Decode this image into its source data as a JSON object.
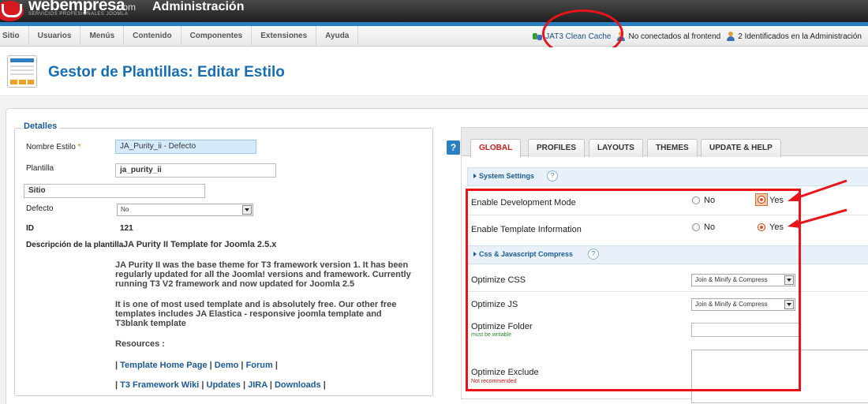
{
  "header": {
    "logo": "webempresa",
    "logo_suffix": ".com",
    "logo_tagline": "SERVICIOS PROFESIONALES JOOMLA",
    "title": "Administración"
  },
  "menu": [
    "Sitio",
    "Usuarios",
    "Menús",
    "Contenido",
    "Componentes",
    "Extensiones",
    "Ayuda"
  ],
  "status": {
    "clean_cache": "JAT3 Clean Cache",
    "frontend": "No conectados al frontend",
    "admin": "2 Identificados en la Administración"
  },
  "toolbar": {
    "title": "Gestor de Plantillas: Editar Estilo"
  },
  "details": {
    "legend": "Detalles",
    "style_name_label": "Nombre Estilo",
    "required_mark": "*",
    "style_name_value": "JA_Purity_ii - Defecto",
    "template_label": "Plantilla",
    "template_value": "ja_purity_ii",
    "client_value": "Sitio",
    "default_label": "Defecto",
    "default_value": "No",
    "id_label": "ID",
    "id_value": "121",
    "desc_label": "Descripción de la plantilla",
    "desc_title": "JA Purity II Template for Joomla 2.5.x",
    "para1_l1": "JA Purity II was the base theme for T3 framework version 1. It has been",
    "para1_l2": "regularly updated for all the Joomla! versions and framework. Currently",
    "para1_l3": "running T3 V2 framework and now updated for Joomla 2.5",
    "para2_l1": "It is one of most used template and is absolutely free. Our other free",
    "para2_l2": "templates includes JA Elastica - responsive joomla template and",
    "para2_l3": "T3blank template",
    "resources": "Resources :",
    "links1": [
      "Template Home Page",
      "Demo",
      "Forum"
    ],
    "links2": [
      "T3 Framework Wiki",
      "Updates",
      "JIRA",
      "Downloads"
    ],
    "separator": "|"
  },
  "help_button": "?",
  "tabs": [
    "GLOBAL",
    "PROFILES",
    "LAYOUTS",
    "THEMES",
    "UPDATE & HELP"
  ],
  "active_tab": "GLOBAL",
  "sections": {
    "system": "System Settings",
    "compress": "Css & Javascript Compress",
    "help_mark": "?"
  },
  "settings": {
    "dev_mode": {
      "label": "Enable Development Mode",
      "no": "No",
      "yes": "Yes",
      "selected": "Yes"
    },
    "tpl_info": {
      "label": "Enable Template Information",
      "no": "No",
      "yes": "Yes",
      "selected": "Yes"
    },
    "opt_css": {
      "label": "Optimize CSS",
      "value": "Join & Minify & Compress"
    },
    "opt_js": {
      "label": "Optimize JS",
      "value": "Join & Minify & Compress"
    },
    "opt_folder": {
      "label": "Optimize Folder",
      "note": "must be writable",
      "value": ""
    },
    "opt_exclude": {
      "label": "Optimize Exclude",
      "note": "Not recommended",
      "value": ""
    }
  },
  "colors": {
    "brand_blue": "#2a7fc1",
    "title_blue": "#166fb6",
    "annotation_red": "#e8141a",
    "active_tab": "#d21a1a",
    "note_green": "#2d8a2d",
    "note_red": "#d01010"
  }
}
